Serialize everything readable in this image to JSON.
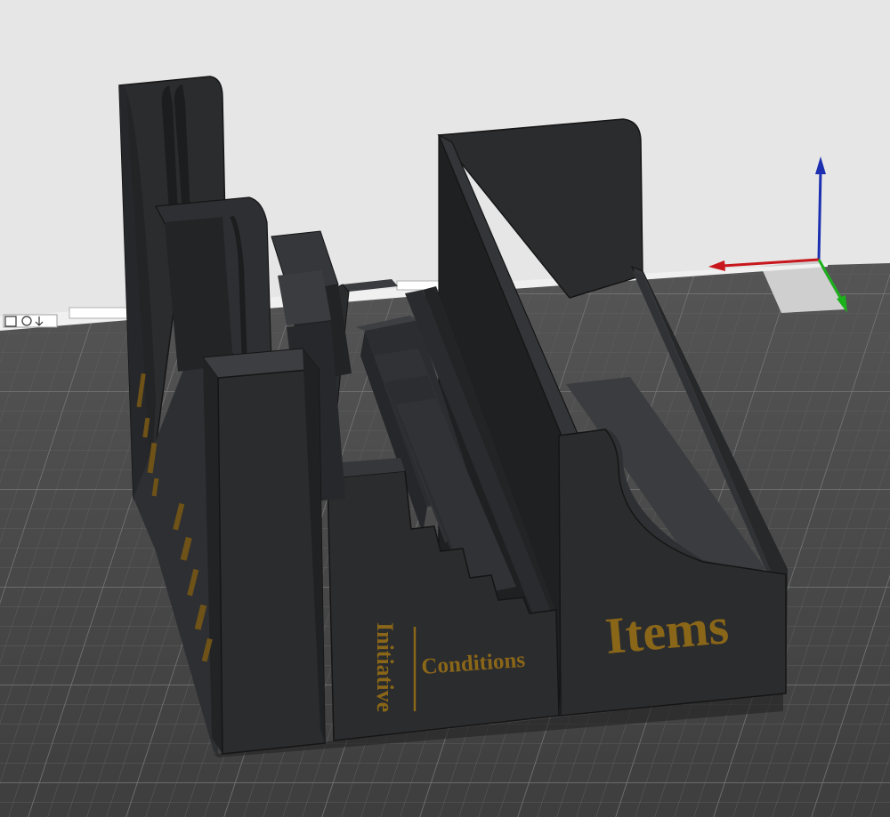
{
  "scene": {
    "labels": {
      "initiative": "Initiative",
      "conditions": "Conditions",
      "items": "Items",
      "left_side_1": "",
      "left_side_2": ""
    },
    "bed_label_left": "",
    "bed_label_right": "",
    "colors": {
      "background": "#e6e6e6",
      "bed": "#4a4a4a",
      "grid_line": "#6b6b6b",
      "model": "#2b2c2e",
      "engraving": "#8a6618",
      "axis_x": "#c8161d",
      "axis_y": "#1bb11b",
      "axis_z": "#1b2fb0"
    },
    "icons": [
      "view-cube-icon",
      "axis-gizmo-x",
      "axis-gizmo-y",
      "axis-gizmo-z"
    ]
  }
}
